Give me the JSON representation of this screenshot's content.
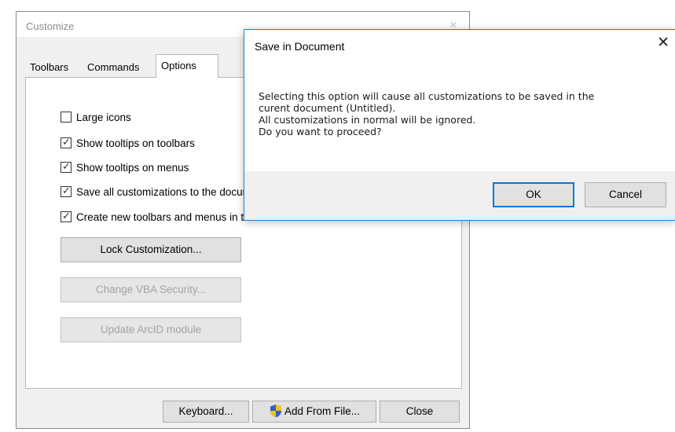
{
  "customize": {
    "title": "Customize",
    "close_glyph": "✕",
    "tabs": [
      {
        "label": "Toolbars"
      },
      {
        "label": "Commands"
      },
      {
        "label": "Options"
      }
    ],
    "options": [
      {
        "label": "Large icons",
        "checked": false
      },
      {
        "label": "Show tooltips on toolbars",
        "checked": true
      },
      {
        "label": "Show tooltips on menus",
        "checked": true
      },
      {
        "label": "Save all customizations to the document",
        "checked": true
      },
      {
        "label": "Create new toolbars and menus in the document",
        "checked": true
      }
    ],
    "buttons": {
      "lock": "Lock Customization...",
      "vba": "Change VBA Security...",
      "arcid": "Update ArcID module"
    },
    "footer": {
      "keyboard": "Keyboard...",
      "add_from_file": "Add From File...",
      "close": "Close"
    }
  },
  "dialog": {
    "title": "Save in Document",
    "close_glyph": "✕",
    "message_lines": [
      "Selecting this option will cause all customizations to be saved in the",
      "curent document (Untitled).",
      "All customizations in normal will be ignored.",
      "Do you want to proceed?"
    ],
    "ok": "OK",
    "cancel": "Cancel"
  },
  "colors": {
    "accent": "#0078d7",
    "dialog_border": "#1883d7",
    "shield_blue": "#2b5fc9",
    "shield_yellow": "#f2c40d"
  }
}
